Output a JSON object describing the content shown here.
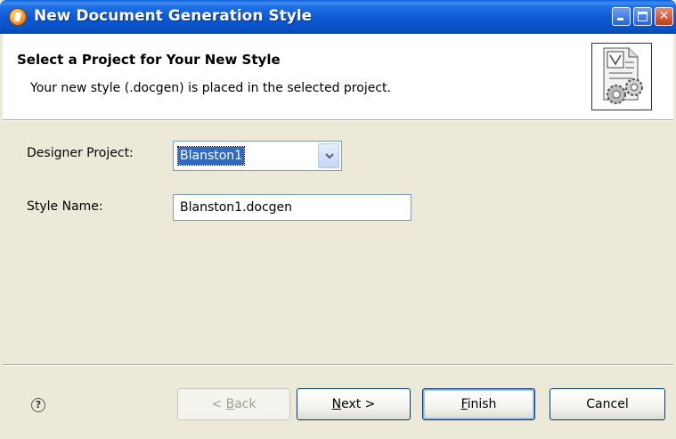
{
  "window": {
    "title": "New Document Generation Style",
    "app_icon": "app-globe-icon",
    "controls": [
      "minimize-icon",
      "maximize-icon",
      "close-icon"
    ]
  },
  "header": {
    "title": "Select a Project for Your New Style",
    "description": "Your new style (.docgen) is placed in the selected project.",
    "image": "document-gears-icon"
  },
  "form": {
    "project_label": "Designer Project:",
    "project_value": "Blanston1",
    "style_label": "Style Name:",
    "style_value": "Blanston1.docgen"
  },
  "buttons": {
    "help": "?",
    "back": {
      "pre": "< ",
      "mnemonic": "B",
      "post": "ack"
    },
    "next": {
      "pre": "",
      "mnemonic": "N",
      "post": "ext >"
    },
    "finish": {
      "pre": "",
      "mnemonic": "F",
      "post": "inish"
    },
    "cancel": "Cancel"
  },
  "colors": {
    "titlebar": "#0b57d3",
    "dialog_bg": "#ece9d8",
    "selection": "#316ac5"
  }
}
